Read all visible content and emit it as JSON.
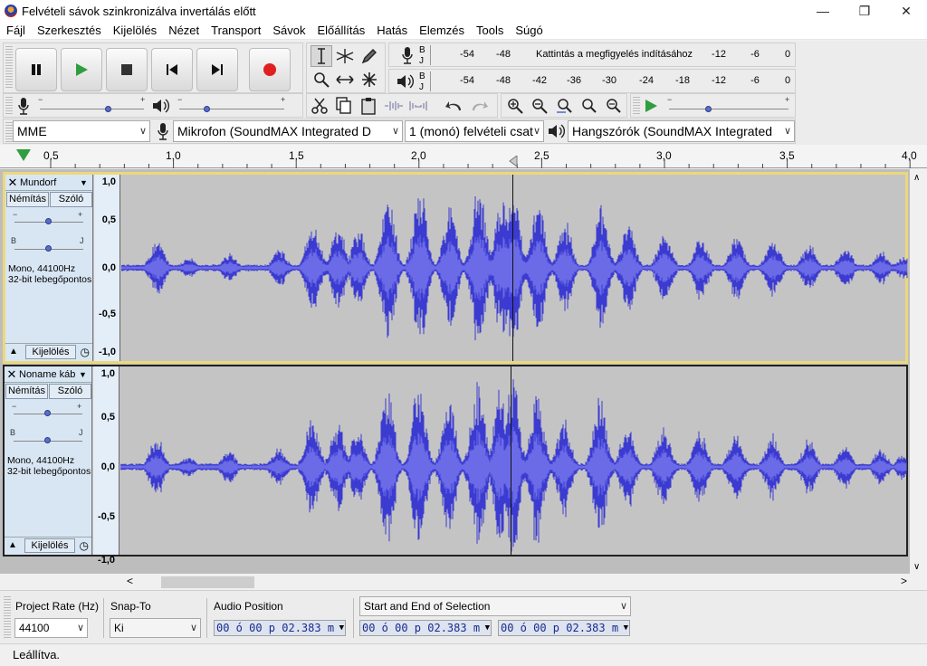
{
  "window": {
    "title": "Felvételi sávok szinkronizálva invertálás előtt",
    "minimize": "—",
    "maximize": "❐",
    "close": "✕"
  },
  "menu": [
    "Fájl",
    "Szerkesztés",
    "Kijelölés",
    "Nézet",
    "Transport",
    "Sávok",
    "Előállítás",
    "Hatás",
    "Elemzés",
    "Tools",
    "Súgó"
  ],
  "meters": {
    "record": {
      "ticks": [
        "-54",
        "-48",
        "-12",
        "-6",
        "0"
      ],
      "hint": "Kattintás a megfigyelés indításához",
      "l": "B",
      "r": "J"
    },
    "playback": {
      "ticks": [
        "-54",
        "-48",
        "-42",
        "-36",
        "-30",
        "-24",
        "-18",
        "-12",
        "-6",
        "0"
      ],
      "l": "B",
      "r": "J"
    }
  },
  "sliders": {
    "minus": "−",
    "plus": "+"
  },
  "device": {
    "host": "MME",
    "input": "Mikrofon (SoundMAX Integrated D",
    "channels": "1 (monó) felvételi csat",
    "output": "Hangszórók (SoundMAX Integrated"
  },
  "ruler": {
    "labels": [
      "0,5",
      "1,0",
      "1,5",
      "2,0",
      "2,5",
      "3,0",
      "3,5",
      "4,0"
    ]
  },
  "tracks": [
    {
      "name": "Mundorf",
      "mute": "Némítás",
      "solo": "Szóló",
      "info1": "Mono, 44100Hz",
      "info2": "32-bit lebegőpontos",
      "select": "Kijelölés",
      "pan_l": "B",
      "pan_r": "J",
      "gain_minus": "−",
      "gain_plus": "+",
      "vlabels": [
        "1,0",
        "0,5",
        "0,0",
        "-0,5",
        "-1,0"
      ]
    },
    {
      "name": "Noname káb",
      "mute": "Némítás",
      "solo": "Szóló",
      "info1": "Mono, 44100Hz",
      "info2": "32-bit lebegőpontos",
      "select": "Kijelölés",
      "pan_l": "B",
      "pan_r": "J",
      "gain_minus": "−",
      "gain_plus": "+",
      "vlabels": [
        "1,0",
        "0,5",
        "0,0",
        "-0,5",
        "-1,0"
      ]
    }
  ],
  "selection_toolbar": {
    "rate_label": "Project Rate (Hz)",
    "rate_value": "44100",
    "snap_label": "Snap-To",
    "snap_value": "Ki",
    "audio_pos_label": "Audio Position",
    "audio_pos_value": "00 ó 00 p 02.383 m",
    "sel_mode": "Start and End of Selection",
    "sel_start": "00 ó 00 p 02.383 m",
    "sel_end": "00 ó 00 p 02.383 m"
  },
  "status": "Leállítva.",
  "colors": {
    "waveform": "#3b3bd1",
    "waveform_rms": "#6b6be8",
    "play_green": "#2e9e3e",
    "record_red": "#e02020",
    "active_track_border": "#ecd87c"
  }
}
